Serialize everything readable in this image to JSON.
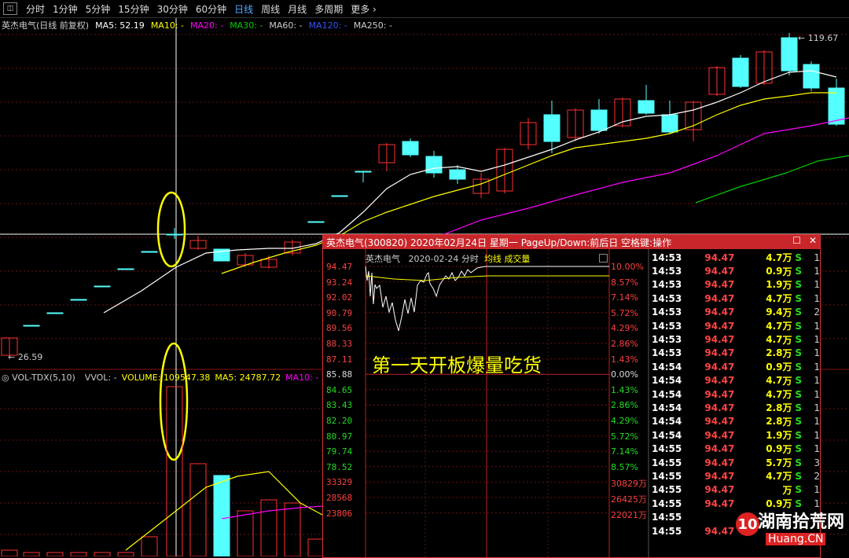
{
  "toolbar": {
    "tabs": [
      "分时",
      "1分钟",
      "5分钟",
      "15分钟",
      "30分钟",
      "60分钟",
      "日线",
      "周线",
      "月线",
      "多周期",
      "更多"
    ],
    "active_tab": "日线"
  },
  "legend": {
    "name": "英杰电气(日线 前复权)",
    "ma5": "MA5: 52.19",
    "ma10": "MA10: -",
    "ma20": "MA20: -",
    "ma30": "MA30: -",
    "ma60": "MA60: -",
    "ma120": "MA120: -",
    "ma250": "MA250: -"
  },
  "price_high": "119.67",
  "price_low": "26.59",
  "vol_legend": {
    "name": "VOL-TDX(5,10)",
    "vvol": "VVOL: -",
    "volume": "VOLUME: 109547.38",
    "ma5": "MA5: 24787.72",
    "ma10": "MA10: -"
  },
  "popup": {
    "title": "英杰电气(300820)  2020年02月24日  星期一  PageUp/Down:前后日  空格键:操作",
    "header_name": "英杰电气",
    "header_date": "2020-02-24 分时",
    "header_avg": "均线",
    "header_vol": "成交量",
    "prices": [
      "94.47",
      "93.24",
      "92.02",
      "90.79",
      "89.56",
      "88.33",
      "87.11",
      "85.88",
      "84.65",
      "83.43",
      "82.20",
      "80.97",
      "79.74",
      "78.52",
      "33329",
      "28568",
      "23806"
    ],
    "pcts": [
      "10.00%",
      "8.57%",
      "7.14%",
      "5.72%",
      "4.29%",
      "2.86%",
      "1.43%",
      "0.00%",
      "1.43%",
      "2.86%",
      "4.29%",
      "5.72%",
      "7.14%",
      "8.57%",
      "30829万",
      "26425万",
      "22021万"
    ],
    "annotation": "第一天开板爆量吃货",
    "ticks": [
      {
        "t": "14:53",
        "p": "94.47",
        "v": "4.7",
        "u": "万",
        "s": "S",
        "n": "1"
      },
      {
        "t": "14:53",
        "p": "94.47",
        "v": "0.9",
        "u": "万",
        "s": "S",
        "n": "1"
      },
      {
        "t": "14:53",
        "p": "94.47",
        "v": "1.9",
        "u": "万",
        "s": "S",
        "n": "1"
      },
      {
        "t": "14:53",
        "p": "94.47",
        "v": "4.7",
        "u": "万",
        "s": "S",
        "n": "1"
      },
      {
        "t": "14:53",
        "p": "94.47",
        "v": "9.4",
        "u": "万",
        "s": "S",
        "n": "2"
      },
      {
        "t": "14:53",
        "p": "94.47",
        "v": "4.7",
        "u": "万",
        "s": "S",
        "n": "1"
      },
      {
        "t": "14:53",
        "p": "94.47",
        "v": "4.7",
        "u": "万",
        "s": "S",
        "n": "1"
      },
      {
        "t": "14:53",
        "p": "94.47",
        "v": "2.8",
        "u": "万",
        "s": "S",
        "n": "1"
      },
      {
        "t": "14:54",
        "p": "94.47",
        "v": "0.9",
        "u": "万",
        "s": "S",
        "n": "1"
      },
      {
        "t": "14:54",
        "p": "94.47",
        "v": "4.7",
        "u": "万",
        "s": "S",
        "n": "1"
      },
      {
        "t": "14:54",
        "p": "94.47",
        "v": "4.7",
        "u": "万",
        "s": "S",
        "n": "1"
      },
      {
        "t": "14:54",
        "p": "94.47",
        "v": "2.8",
        "u": "万",
        "s": "S",
        "n": "1"
      },
      {
        "t": "14:54",
        "p": "94.47",
        "v": "2.8",
        "u": "万",
        "s": "S",
        "n": "1"
      },
      {
        "t": "14:54",
        "p": "94.47",
        "v": "1.9",
        "u": "万",
        "s": "S",
        "n": "1"
      },
      {
        "t": "14:55",
        "p": "94.47",
        "v": "0.9",
        "u": "万",
        "s": "S",
        "n": "1"
      },
      {
        "t": "14:55",
        "p": "94.47",
        "v": "5.7",
        "u": "万",
        "s": "S",
        "n": "3"
      },
      {
        "t": "14:55",
        "p": "94.47",
        "v": "4.7",
        "u": "万",
        "s": "S",
        "n": "2"
      },
      {
        "t": "14:55",
        "p": "94.47",
        "v": "",
        "u": "万",
        "s": "S",
        "n": "1"
      },
      {
        "t": "14:55",
        "p": "94.47",
        "v": "0.9",
        "u": "万",
        "s": "S",
        "n": "1"
      },
      {
        "t": "14:55",
        "p": "",
        "v": "",
        "u": "",
        "s": "",
        "n": ""
      },
      {
        "t": "14:55",
        "p": "94.47",
        "v": "",
        "u": "",
        "s": "",
        "n": ""
      }
    ]
  },
  "watermark": {
    "text": "湖南拾荒网",
    "site": "Huang.CN",
    "logo": "10"
  },
  "colors": {
    "up": "#ff3030",
    "down": "#54ffff",
    "ma5": "#ffffff",
    "ma10": "#ffff00",
    "ma20": "#ff00ff",
    "ma30": "#00cc00",
    "ma60": "#cccccc",
    "ma120": "#3050ff"
  }
}
